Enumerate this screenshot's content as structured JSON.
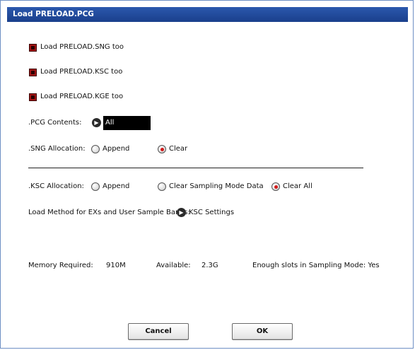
{
  "dialog": {
    "title": "Load PRELOAD.PCG"
  },
  "options": {
    "load_sng": "Load PRELOAD.SNG too",
    "load_ksc": "Load PRELOAD.KSC too",
    "load_kge": "Load PRELOAD.KGE too"
  },
  "pcg_contents": {
    "label": ".PCG Contents:",
    "value": "All"
  },
  "sng_allocation": {
    "label": ".SNG Allocation:",
    "append": "Append",
    "clear": "Clear",
    "selected": "Clear"
  },
  "ksc_allocation": {
    "label": ".KSC Allocation:",
    "append": "Append",
    "clear_sampling": "Clear Sampling Mode Data",
    "clear_all": "Clear All",
    "selected": "Clear All"
  },
  "load_method": {
    "label": "Load Method for EXs and User Sample Banks:",
    "button": "KSC Settings"
  },
  "memory": {
    "required_label": "Memory Required:",
    "required_value": "910M",
    "available_label": "Available:",
    "available_value": "2.3G",
    "slots_label": "Enough slots in Sampling Mode: Yes"
  },
  "buttons": {
    "cancel": "Cancel",
    "ok": "OK"
  },
  "colors": {
    "titlebar": "#1f4a9c",
    "checkbox": "#a31414",
    "radio_on": "#d31a1a"
  }
}
